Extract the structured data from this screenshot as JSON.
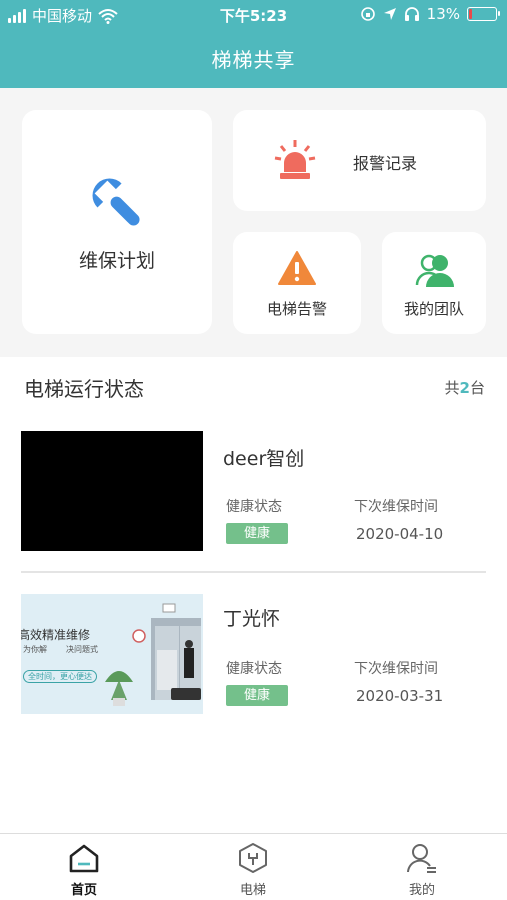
{
  "status_bar": {
    "carrier": "中国移动",
    "time": "下午5:23",
    "battery": "13%",
    "battery_level": 0.13
  },
  "header": {
    "title": "梯梯共享"
  },
  "cards": {
    "maintenance_plan": "维保计划",
    "alarm_records": "报警记录",
    "elevator_warning": "电梯告警",
    "my_team": "我的团队"
  },
  "section": {
    "title": "电梯运行状态",
    "count_prefix": "共",
    "count": "2",
    "count_suffix": "台"
  },
  "elevators": [
    {
      "name": "deer智创",
      "health_label": "健康状态",
      "health_value": "健康",
      "next_label": "下次维保时间",
      "next_date": "2020-04-10"
    },
    {
      "name": "丁光怀",
      "health_label": "健康状态",
      "health_value": "健康",
      "next_label": "下次维保时间",
      "next_date": "2020-03-31",
      "image_text": {
        "headline": "高效精准维修",
        "sub1": "为你解",
        "sub2": "决问题式",
        "sub3": "全时间，更心便达"
      }
    }
  ],
  "tabs": [
    {
      "label": "首页",
      "active": true
    },
    {
      "label": "电梯",
      "active": false
    },
    {
      "label": "我的",
      "active": false
    }
  ],
  "colors": {
    "primary": "#4fb9bd",
    "wrench": "#3f8de0",
    "alarm": "#ef6b5e",
    "warning": "#f0883a",
    "team": "#3fb36b",
    "badge": "#74c08b"
  }
}
